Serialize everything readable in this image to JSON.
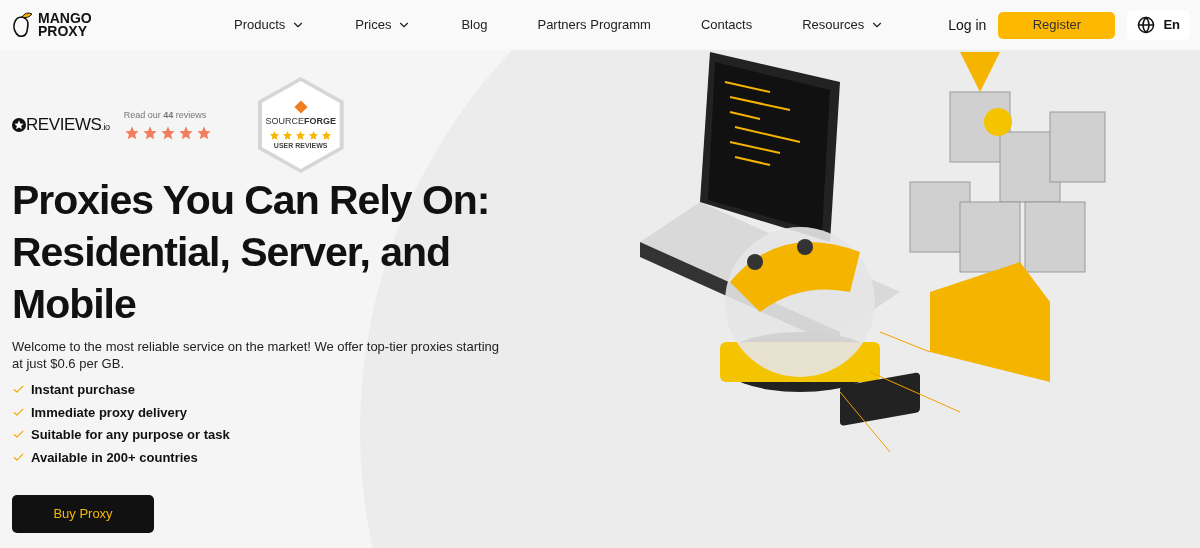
{
  "logo": {
    "line_1": "MANGO",
    "line_2": "PROXY"
  },
  "nav": [
    {
      "label": "Products",
      "dropdown": true
    },
    {
      "label": "Prices",
      "dropdown": true
    },
    {
      "label": "Blog",
      "dropdown": false
    },
    {
      "label": "Partners Programm",
      "dropdown": false
    },
    {
      "label": "Contacts",
      "dropdown": false
    },
    {
      "label": "Resources",
      "dropdown": true
    }
  ],
  "login": "Log in",
  "register": "Register",
  "language": "En",
  "reviews_io": {
    "brand": "REVIEWS",
    "suffix": ".io",
    "caption": "Read our **44** reviews",
    "stars": 5
  },
  "sourceforge": {
    "brand_1": "SOURCE",
    "brand_2": "FORGE",
    "caption": "USER REVIEWS",
    "stars": 5
  },
  "headline": "Proxies You Can Rely On: Residential, Server, and Mobile",
  "intro": "Welcome to the most reliable service on the market! We offer top-tier proxies starting at just $0.6 per GB.",
  "features": [
    "Instant purchase",
    "Immediate proxy delivery",
    "Suitable for any purpose or task",
    "Available in 200+ countries"
  ],
  "cta": "Buy Proxy"
}
